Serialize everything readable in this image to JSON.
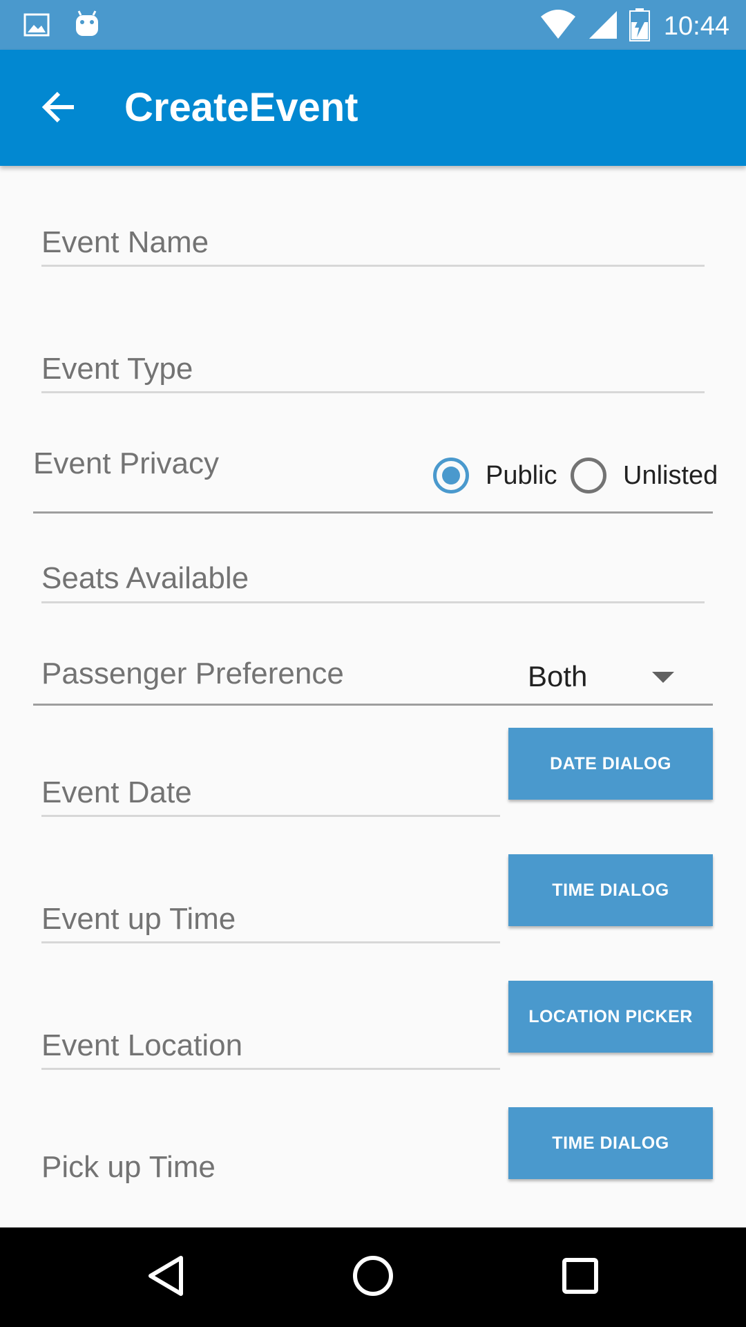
{
  "status_bar": {
    "time": "10:44",
    "icons": [
      "image-icon",
      "android-icon",
      "wifi-icon",
      "signal-icon",
      "battery-charging-icon"
    ],
    "color": "#4a99cd"
  },
  "app_bar": {
    "title": "CreateEvent",
    "back_icon": "arrow-left-icon",
    "color": "#0288d1"
  },
  "form": {
    "event_name": {
      "placeholder": "Event Name",
      "value": ""
    },
    "event_type": {
      "placeholder": "Event Type",
      "value": ""
    },
    "event_privacy": {
      "label": "Event Privacy",
      "options": [
        {
          "label": "Public",
          "checked": true
        },
        {
          "label": "Unlisted",
          "checked": false
        }
      ]
    },
    "seats_available": {
      "placeholder": "Seats Available",
      "value": ""
    },
    "passenger_preference": {
      "label": "Passenger Preference",
      "selected": "Both"
    },
    "event_date": {
      "placeholder": "Event Date",
      "value": "",
      "button": "DATE DIALOG"
    },
    "event_up_time": {
      "placeholder": "Event up Time",
      "value": "",
      "button": "TIME DIALOG"
    },
    "event_location": {
      "placeholder": "Event Location",
      "value": "",
      "button": "LOCATION PICKER"
    },
    "pick_up_time": {
      "label": "Pick up Time",
      "button": "TIME DIALOG"
    }
  },
  "nav_bar": {
    "icons": [
      "back-triangle-icon",
      "home-circle-icon",
      "recents-square-icon"
    ]
  }
}
